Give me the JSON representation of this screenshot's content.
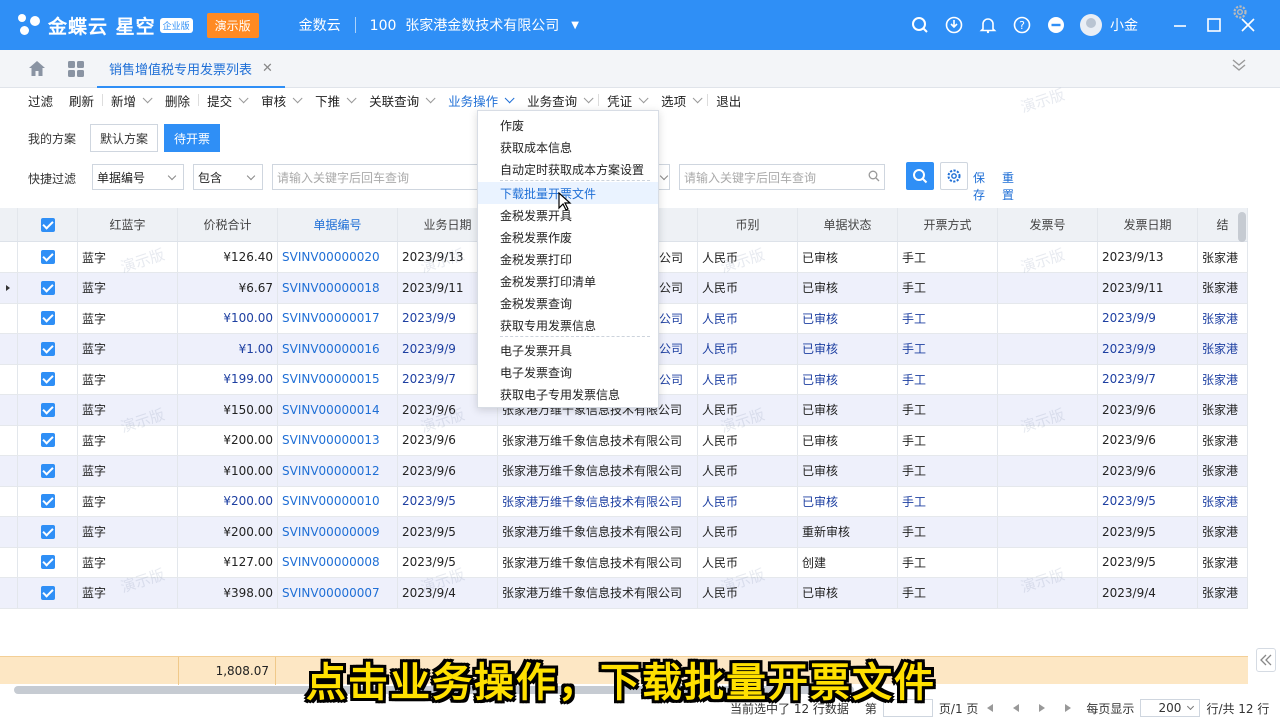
{
  "topbar": {
    "product": "金蝶云 星空",
    "badge": "企业版",
    "demo_label": "演示版",
    "app": "金数云",
    "company_code": "100",
    "company": "张家港金数技术有限公司",
    "user": "小金",
    "accent": "#2f8ff6"
  },
  "tabs": {
    "active": "销售增值税专用发票列表"
  },
  "toolbar": [
    {
      "label": "过滤",
      "caret": false
    },
    {
      "label": "刷新",
      "caret": false
    },
    {
      "label": "新增",
      "caret": true
    },
    {
      "label": "删除",
      "caret": false
    },
    {
      "label": "提交",
      "caret": true
    },
    {
      "label": "审核",
      "caret": true
    },
    {
      "label": "下推",
      "caret": true
    },
    {
      "label": "关联查询",
      "caret": true
    },
    {
      "label": "业务操作",
      "caret": true,
      "active": true
    },
    {
      "label": "业务查询",
      "caret": true
    },
    {
      "label": "凭证",
      "caret": true
    },
    {
      "label": "选项",
      "caret": true
    },
    {
      "label": "退出",
      "caret": false
    }
  ],
  "filters": {
    "plan_label": "我的方案",
    "plans": [
      "默认方案",
      "待开票"
    ],
    "quick_label": "快捷过滤",
    "field": "单据编号",
    "op": "包含",
    "placeholder": "请输入关键字后回车查询",
    "save": "保存",
    "reset": "重置"
  },
  "columns": [
    "红蓝字",
    "价税合计",
    "单据编号",
    "业务日期",
    "币别",
    "单据状态",
    "开票方式",
    "发票号",
    "发票日期",
    "结"
  ],
  "rows": [
    {
      "rb": "蓝字",
      "amount": "¥126.40",
      "num": "SVINV00000020",
      "date": "2023/9/13",
      "cust": "公司",
      "cur": "人民币",
      "status": "已审核",
      "type": "手工",
      "idate": "2023/9/13",
      "last": "张家港",
      "blue": false
    },
    {
      "rb": "蓝字",
      "amount": "¥6.67",
      "num": "SVINV00000018",
      "date": "2023/9/11",
      "cust": "公司",
      "cur": "人民币",
      "status": "已审核",
      "type": "手工",
      "idate": "2023/9/11",
      "last": "张家港",
      "blue": false
    },
    {
      "rb": "蓝字",
      "amount": "¥100.00",
      "num": "SVINV00000017",
      "date": "2023/9/9",
      "cust": "公司",
      "cur": "人民币",
      "status": "已审核",
      "type": "手工",
      "idate": "2023/9/9",
      "last": "张家港",
      "blue": true
    },
    {
      "rb": "蓝字",
      "amount": "¥1.00",
      "num": "SVINV00000016",
      "date": "2023/9/9",
      "cust": "公司",
      "cur": "人民币",
      "status": "已审核",
      "type": "手工",
      "idate": "2023/9/9",
      "last": "张家港",
      "blue": true
    },
    {
      "rb": "蓝字",
      "amount": "¥199.00",
      "num": "SVINV00000015",
      "date": "2023/9/7",
      "cust": "公司",
      "cur": "人民币",
      "status": "已审核",
      "type": "手工",
      "idate": "2023/9/7",
      "last": "张家港",
      "blue": true
    },
    {
      "rb": "蓝字",
      "amount": "¥150.00",
      "num": "SVINV00000014",
      "date": "2023/9/6",
      "cust": "张家港万维千象信息技术有限公司",
      "cur": "人民币",
      "status": "已审核",
      "type": "手工",
      "idate": "2023/9/6",
      "last": "张家港",
      "blue": false
    },
    {
      "rb": "蓝字",
      "amount": "¥200.00",
      "num": "SVINV00000013",
      "date": "2023/9/6",
      "cust": "张家港万维千象信息技术有限公司",
      "cur": "人民币",
      "status": "已审核",
      "type": "手工",
      "idate": "2023/9/6",
      "last": "张家港",
      "blue": false
    },
    {
      "rb": "蓝字",
      "amount": "¥100.00",
      "num": "SVINV00000012",
      "date": "2023/9/6",
      "cust": "张家港万维千象信息技术有限公司",
      "cur": "人民币",
      "status": "已审核",
      "type": "手工",
      "idate": "2023/9/6",
      "last": "张家港",
      "blue": false
    },
    {
      "rb": "蓝字",
      "amount": "¥200.00",
      "num": "SVINV00000010",
      "date": "2023/9/5",
      "cust": "张家港万维千象信息技术有限公司",
      "cur": "人民币",
      "status": "已审核",
      "type": "手工",
      "idate": "2023/9/5",
      "last": "张家港",
      "blue": true
    },
    {
      "rb": "蓝字",
      "amount": "¥200.00",
      "num": "SVINV00000009",
      "date": "2023/9/5",
      "cust": "张家港万维千象信息技术有限公司",
      "cur": "人民币",
      "status": "重新审核",
      "type": "手工",
      "idate": "2023/9/5",
      "last": "张家港",
      "blue": false
    },
    {
      "rb": "蓝字",
      "amount": "¥127.00",
      "num": "SVINV00000008",
      "date": "2023/9/5",
      "cust": "张家港万维千象信息技术有限公司",
      "cur": "人民币",
      "status": "创建",
      "type": "手工",
      "idate": "2023/9/5",
      "last": "张家港",
      "blue": false
    },
    {
      "rb": "蓝字",
      "amount": "¥398.00",
      "num": "SVINV00000007",
      "date": "2023/9/4",
      "cust": "张家港万维千象信息技术有限公司",
      "cur": "人民币",
      "status": "已审核",
      "type": "手工",
      "idate": "2023/9/4",
      "last": "张家港",
      "blue": false
    }
  ],
  "total": "1,808.07",
  "watermark": "演示版",
  "pager": {
    "text_left": "当前选中了 12 行数据",
    "page_label": "第",
    "page_suffix": "页/1 页",
    "per_page_label": "每页显示",
    "per_page": "200",
    "total_rows": "行/共 12 行"
  },
  "menu": {
    "items": [
      "作废",
      "获取成本信息",
      "自动定时获取成本方案设置",
      "下载批量开票文件",
      "金税发票开具",
      "金税发票作废",
      "金税发票打印",
      "金税发票打印清单",
      "金税发票查询",
      "获取专用发票信息",
      "电子发票开具",
      "电子发票查询",
      "获取电子专用发票信息"
    ],
    "hover_index": 3
  },
  "caption": "点击业务操作，下载批量开票文件"
}
